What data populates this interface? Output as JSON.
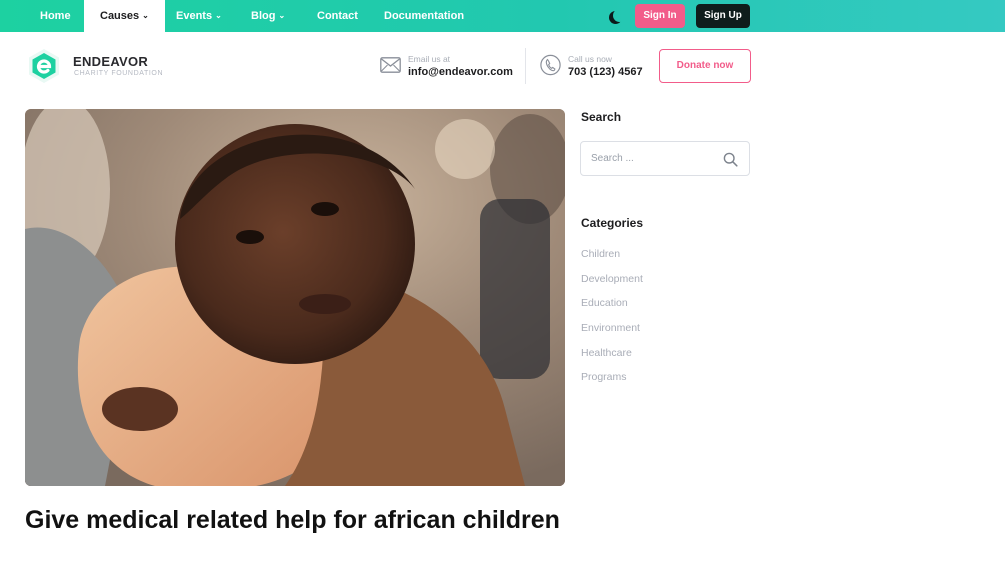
{
  "nav": {
    "items": [
      {
        "label": "Home",
        "dropdown": false,
        "active": false
      },
      {
        "label": "Causes",
        "dropdown": true,
        "active": true
      },
      {
        "label": "Events",
        "dropdown": true,
        "active": false
      },
      {
        "label": "Blog",
        "dropdown": true,
        "active": false
      },
      {
        "label": "Contact",
        "dropdown": false,
        "active": false
      },
      {
        "label": "Documentation",
        "dropdown": false,
        "active": false
      }
    ],
    "theme_icon": "moon-icon",
    "signin_label": "Sign In",
    "signup_label": "Sign Up"
  },
  "brand": {
    "name": "ENDEAVOR",
    "tagline": "CHARITY FOUNDATION",
    "logo_icon": "endeavor-logo-icon"
  },
  "contact": {
    "email_label": "Email us at",
    "email": "info@endeavor.com",
    "phone_label": "Call us now",
    "phone": "703 (123) 4567"
  },
  "donate_label": "Donate now",
  "sidebar": {
    "search_title": "Search",
    "search_placeholder": "Search ...",
    "categories_title": "Categories",
    "categories": [
      "Children",
      "Development",
      "Education",
      "Environment",
      "Healthcare",
      "Programs"
    ]
  },
  "post": {
    "title": "Give medical related help for african children"
  },
  "colors": {
    "accent_green": "#1dd1a1",
    "accent_pink": "#f25c8a",
    "dark": "#0f1d1c"
  }
}
